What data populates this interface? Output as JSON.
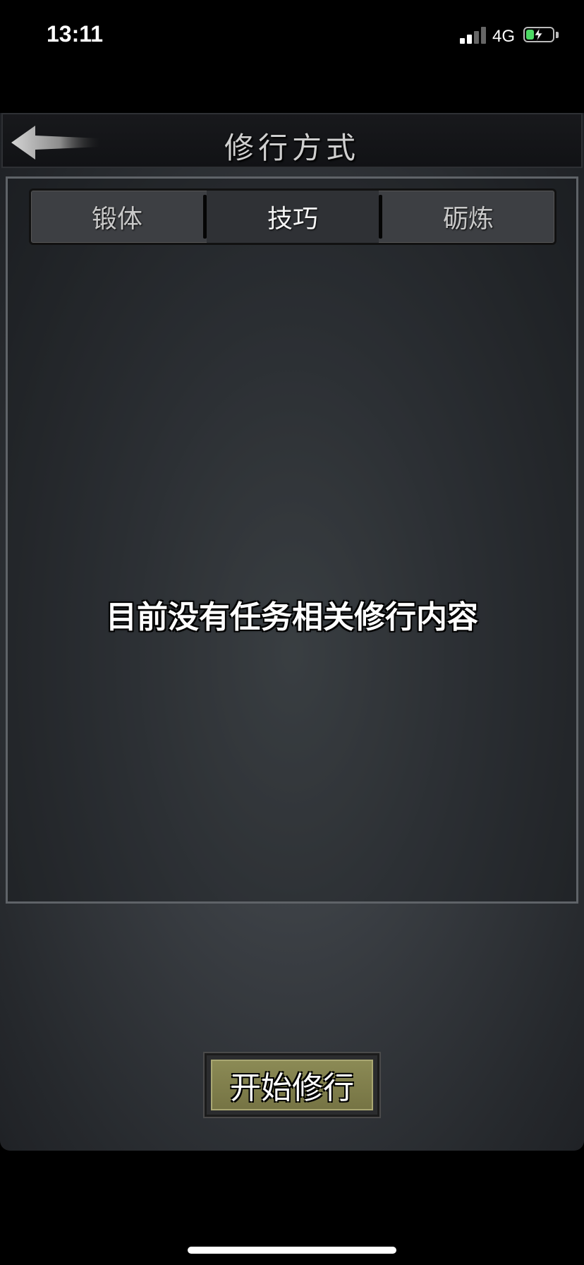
{
  "status_bar": {
    "time": "13:11",
    "network": "4G",
    "signal_bars": 4,
    "signal_bars_active": 2,
    "battery_level": 0.3,
    "battery_charging": true,
    "signal_icon": "signal-bars-icon",
    "battery_icon": "battery-charging-icon"
  },
  "header": {
    "title": "修行方式",
    "back_icon": "arrow-left-icon"
  },
  "tabs": [
    {
      "label": "锻体",
      "active": false
    },
    {
      "label": "技巧",
      "active": true
    },
    {
      "label": "砺炼",
      "active": false
    }
  ],
  "content": {
    "empty_message": "目前没有任务相关修行内容"
  },
  "actions": {
    "start_label": "开始修行"
  },
  "colors": {
    "background": "#000000",
    "panel_border": "#5f6368",
    "button_face": "#8b8a55",
    "battery_green": "#4cd964"
  }
}
